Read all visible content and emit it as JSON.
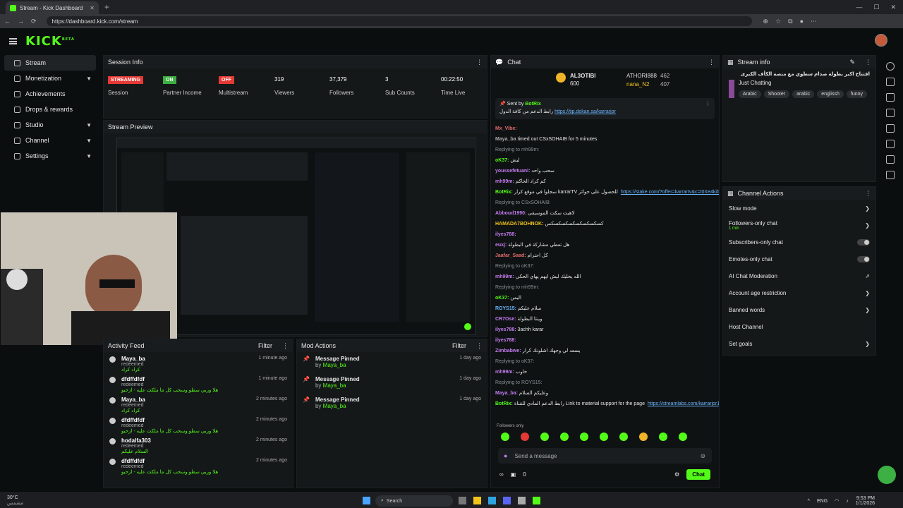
{
  "browser": {
    "tab_title": "Stream - Kick Dashboard",
    "url": "https://dashboard.kick.com/stream"
  },
  "brand": {
    "logo": "KICK",
    "logo_sup": "BETA",
    "accent": "#53fc18"
  },
  "sidebar": {
    "items": [
      {
        "label": "Stream",
        "active": true
      },
      {
        "label": "Monetization",
        "chevron": true
      },
      {
        "label": "Achievements"
      },
      {
        "label": "Drops & rewards"
      },
      {
        "label": "Studio",
        "chevron": true
      },
      {
        "label": "Channel",
        "chevron": true
      },
      {
        "label": "Settings",
        "chevron": true
      }
    ]
  },
  "session": {
    "title": "Session Info",
    "cells": [
      {
        "badge": "STREAMING",
        "badge_color": "#e53935",
        "label": "Session"
      },
      {
        "badge": "ON",
        "badge_color": "#3cb043",
        "label": "Partner Income"
      },
      {
        "badge": "OFF",
        "badge_color": "#e53935",
        "label": "Multistream"
      },
      {
        "value": "319",
        "label": "Viewers"
      },
      {
        "value": "37,379",
        "label": "Followers"
      },
      {
        "value": "3",
        "label": "Sub Counts"
      },
      {
        "value": "00:22:50",
        "label": "Time Live"
      }
    ]
  },
  "preview": {
    "title": "Stream Preview"
  },
  "activity": {
    "title": "Activity Feed",
    "filter": "Filter",
    "rows": [
      {
        "name": "Maya_ba",
        "sub": "redeemed",
        "msg": "كراد كراد",
        "time": "1 minute ago"
      },
      {
        "name": "dfdffdfdf",
        "sub": "redeemed",
        "msg": "هلا وربي سطو وسحب كل ما ملكت عليه - ازحبو",
        "time": "1 minute ago"
      },
      {
        "name": "Maya_ba",
        "sub": "redeemed",
        "msg": "كراد كراد",
        "time": "2 minutes ago"
      },
      {
        "name": "dfdffdfdf",
        "sub": "redeemed",
        "msg": "هلا وربي سطو وسحب كل ما ملكت عليه - ازحبو",
        "time": "2 minutes ago"
      },
      {
        "name": "hodalfa303",
        "sub": "redeemed",
        "msg": "السلام عليكم",
        "time": "2 minutes ago"
      },
      {
        "name": "dfdffdfdf",
        "sub": "redeemed",
        "msg": "هلا وربي سطو وسحب كل ما ملكت عليه - ازحبو",
        "time": "2 minutes ago"
      }
    ]
  },
  "mod": {
    "title": "Mod Actions",
    "filter": "Filter",
    "rows": [
      {
        "action": "Message Pinned",
        "by": "by",
        "user": "Maya_ba",
        "time": "1 day ago"
      },
      {
        "action": "Message Pinned",
        "by": "by",
        "user": "Maya_ba",
        "time": "1 day ago"
      },
      {
        "action": "Message Pinned",
        "by": "by",
        "user": "Maya_ba",
        "time": "1 day ago"
      }
    ]
  },
  "chat": {
    "title": "Chat",
    "leaders": [
      {
        "name": "AL3OTIBI",
        "value": "600"
      },
      {
        "name": "ATHORI888",
        "value": "462"
      },
      {
        "name": "nana_N2",
        "value": "407"
      }
    ],
    "pinned": {
      "sent_by": "Sent by",
      "user": "BotRix",
      "text": "رابط الدعم من كافة الدول",
      "link": "https://tip.dokan.sa/karrarjor"
    },
    "lines": [
      {
        "user": "Mx_Vibe:",
        "color": "#e06b6b",
        "text": ""
      },
      {
        "user": "Maya_ba",
        "color": "#aaaaaa",
        "text": "timed out CSxSOHAIB for 5 minutes"
      },
      {
        "user": "oK37:",
        "color": "#53fc18",
        "text": "ليش",
        "reply": "Replying to mh99m:"
      },
      {
        "user": "youssefetuani:",
        "color": "#c37cf0",
        "text": "سحب واحد"
      },
      {
        "user": "mh99m:",
        "color": "#c37cf0",
        "text": "كم كراد الحاكم"
      },
      {
        "user": "BotRix:",
        "color": "#53fc18",
        "text": "سجلوا في موقع كرار karrarTV للحصول على جوائز",
        "link": "https://stake.com/?offer=karrartv&c=t0Xe4kib"
      },
      {
        "user": "Abboud1990:",
        "color": "#c37cf0",
        "text": "لاهيت سكت الموسيقى",
        "reply": "Replying to CSxSOHAIB:"
      },
      {
        "user": "HAMADA7BOHNOK:",
        "color": "#f0c419",
        "text": "كسكسكسكسكسكسكسكس"
      },
      {
        "user": "ilyes788:",
        "color": "#c37cf0",
        "text": ""
      },
      {
        "user": "euxj:",
        "color": "#c37cf0",
        "text": "هل تعطي مشاركة في البطولة"
      },
      {
        "user": "Jaafar_Saad:",
        "color": "#e06b6b",
        "text": "كل احترام"
      },
      {
        "user": "mh99m:",
        "color": "#c37cf0",
        "text": "الله يخليك ليش ايهم يهاي الحكي",
        "reply": "Replying to oK37:"
      },
      {
        "user": "oK37:",
        "color": "#53fc18",
        "text": "اليمن",
        "reply": "Replying to mh99m:"
      },
      {
        "user": "ROYS15:",
        "color": "#6bb7ff",
        "text": "سلام عليكم"
      },
      {
        "user": "CR7Ose:",
        "color": "#c37cf0",
        "text": "وينتا البطولة"
      },
      {
        "user": "ilyes788:",
        "color": "#c37cf0",
        "text": "3achh karar"
      },
      {
        "user": "ilyes788:",
        "color": "#c37cf0",
        "text": ""
      },
      {
        "user": "Zimbabwe:",
        "color": "#c37cf0",
        "text": "يسعد لي وجهك اشلونك كرار"
      },
      {
        "user": "mh99m:",
        "color": "#c37cf0",
        "text": "خاوب",
        "reply": "Replying to oK37:"
      },
      {
        "user": "Maya_ba:",
        "color": "#c37cf0",
        "text": "وعليكم السلام",
        "reply": "Replying to ROYS15:"
      },
      {
        "user": "BotRix:",
        "color": "#53fc18",
        "text": "رابط الدعم المادي للقناة Link to material support for the page",
        "link": "https://streamlabs.com/karrarjor1/tip"
      }
    ],
    "followers_only": "Followers only",
    "placeholder": "Send a message",
    "count": "0",
    "send": "Chat"
  },
  "stream_info": {
    "title": "Stream info",
    "stream_title": "افتتاح اكبر بطولة صدام سطوي مع منصة الكأف الكبرى",
    "category": "Just Chatting",
    "tags": [
      "Arabic",
      "Shooter",
      "arabic",
      "englissh",
      "funny"
    ]
  },
  "channel_actions": {
    "title": "Channel Actions",
    "items": [
      {
        "label": "Slow mode",
        "kind": "chevron"
      },
      {
        "label": "Followers-only chat",
        "sub": "1 min",
        "kind": "chevron"
      },
      {
        "label": "Subscribers-only chat",
        "kind": "toggle"
      },
      {
        "label": "Emotes-only chat",
        "kind": "toggle"
      },
      {
        "label": "AI Chat Moderation",
        "kind": "external"
      },
      {
        "label": "Account age restriction",
        "kind": "chevron"
      },
      {
        "label": "Banned words",
        "kind": "chevron"
      },
      {
        "label": "Host Channel",
        "kind": "none"
      },
      {
        "label": "Set goals",
        "kind": "chevron"
      }
    ]
  },
  "taskbar": {
    "weather": "30°C",
    "weather_sub": "مشمس",
    "search": "Search",
    "lang": "ENG",
    "time": "9:53 PM",
    "date": "1/1/2026"
  }
}
